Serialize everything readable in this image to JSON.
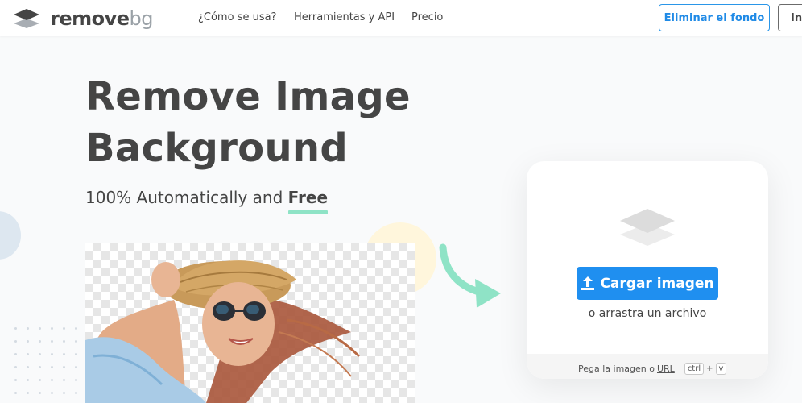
{
  "header": {
    "logo": {
      "word_main": "remove",
      "word_accent": "bg"
    },
    "nav": [
      "¿Cómo se usa?",
      "Herramientas y API",
      "Precio"
    ],
    "cta_remove": "Eliminar el fondo",
    "cta_login_partial": "In"
  },
  "hero": {
    "title_line1": "Remove Image",
    "title_line2": "Background",
    "subtitle_prefix": "100% Automatically and ",
    "subtitle_emphasis": "Free"
  },
  "upload": {
    "button_label": "Cargar imagen",
    "drag_text": "o arrastra un archivo",
    "paste_prefix": "Pega la imagen o",
    "paste_link": "URL",
    "key_ctrl": "ctrl",
    "key_plus": "+",
    "key_v": "v"
  },
  "colors": {
    "brand_blue": "#1f8ff0",
    "accent_green": "#8fe3c6",
    "text_dark": "#454545"
  },
  "icons": {
    "logo": "layers-logo-icon",
    "upload": "upload-arrow-icon",
    "placeholder": "layers-icon",
    "arrow": "curved-arrow-icon"
  }
}
